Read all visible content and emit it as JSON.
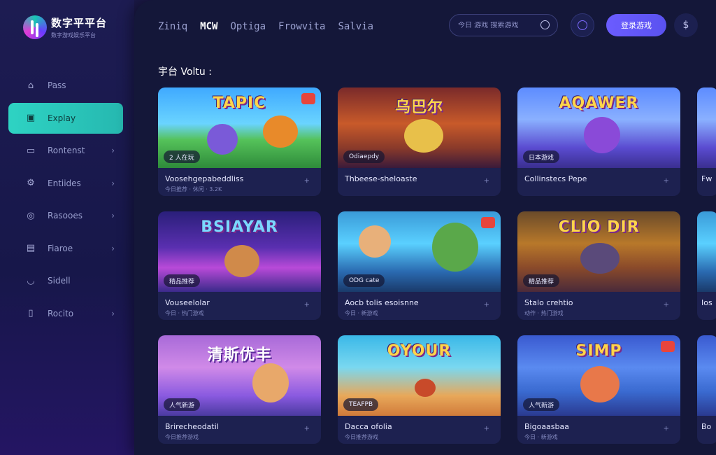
{
  "brand": {
    "name": "数字平平台",
    "tagline": "数字游戏娱乐平台"
  },
  "sidebar": {
    "items": [
      {
        "label": "Pass",
        "icon": "home-icon",
        "active": false,
        "chevron": false
      },
      {
        "label": "Explay",
        "icon": "gamepad-icon",
        "active": true,
        "chevron": false
      },
      {
        "label": "Rontenst",
        "icon": "monitor-icon",
        "active": false,
        "chevron": true
      },
      {
        "label": "Entiides",
        "icon": "gear-icon",
        "active": false,
        "chevron": true
      },
      {
        "label": "Rasooes",
        "icon": "controller-icon",
        "active": false,
        "chevron": true
      },
      {
        "label": "Fiaroe",
        "icon": "photo-icon",
        "active": false,
        "chevron": true
      },
      {
        "label": "Sidell",
        "icon": "cup-icon",
        "active": false,
        "chevron": false
      },
      {
        "label": "Rocito",
        "icon": "phone-icon",
        "active": false,
        "chevron": true
      }
    ]
  },
  "header": {
    "tabs": [
      "Ziniq",
      "MCW",
      "Optiga",
      "Frowvita",
      "Salvia"
    ],
    "active_tab": 1,
    "search_placeholder": "今日 游戏 搜索游戏",
    "primary_button": "登录游戏"
  },
  "section": {
    "title": "宇台 Voltu :"
  },
  "cards": [
    {
      "art": "TAPIC",
      "pill": "2 人在玩",
      "title": "Voosehgepabeddliss",
      "meta": "今日推荐 · 休闲 · 3.2K",
      "more": "+"
    },
    {
      "art": "乌巴尔",
      "pill": "Odiaepdy",
      "title": "Thbeese-sheloaste",
      "meta": "",
      "more": "+"
    },
    {
      "art": "AQAWER",
      "pill": "日本游戏",
      "title": "Collinstecs Pepe",
      "meta": "",
      "more": "+"
    },
    {
      "art": "BSIAYAR",
      "pill": "精品推荐",
      "title": "Vouseelolar",
      "meta": "今日 · 热门游戏",
      "more": "+"
    },
    {
      "art": "",
      "pill": "ODG cate",
      "title": "Aocb tolis esoisnne",
      "meta": "今日 · 新游戏",
      "more": "+"
    },
    {
      "art": "CLIO DIR",
      "pill": "精品推荐",
      "title": "Stalo crehtio",
      "meta": "动作 · 热门游戏",
      "more": "+"
    },
    {
      "art": "清斯优丰",
      "pill": "人气新游",
      "title": "Brirecheodatil",
      "meta": "今日推荐游戏",
      "more": "+"
    },
    {
      "art": "OYOUR",
      "pill": "TEAFPB",
      "title": "Dacca ofolia",
      "meta": "今日推荐游戏",
      "more": "+"
    },
    {
      "art": "SIMP",
      "pill": "人气新游",
      "title": "Bigoaasbaa",
      "meta": "今日 · 新游戏",
      "more": "+"
    }
  ],
  "peek_cards": [
    {
      "title": "Fw"
    },
    {
      "title": "Ios"
    },
    {
      "title": "Bo"
    }
  ]
}
